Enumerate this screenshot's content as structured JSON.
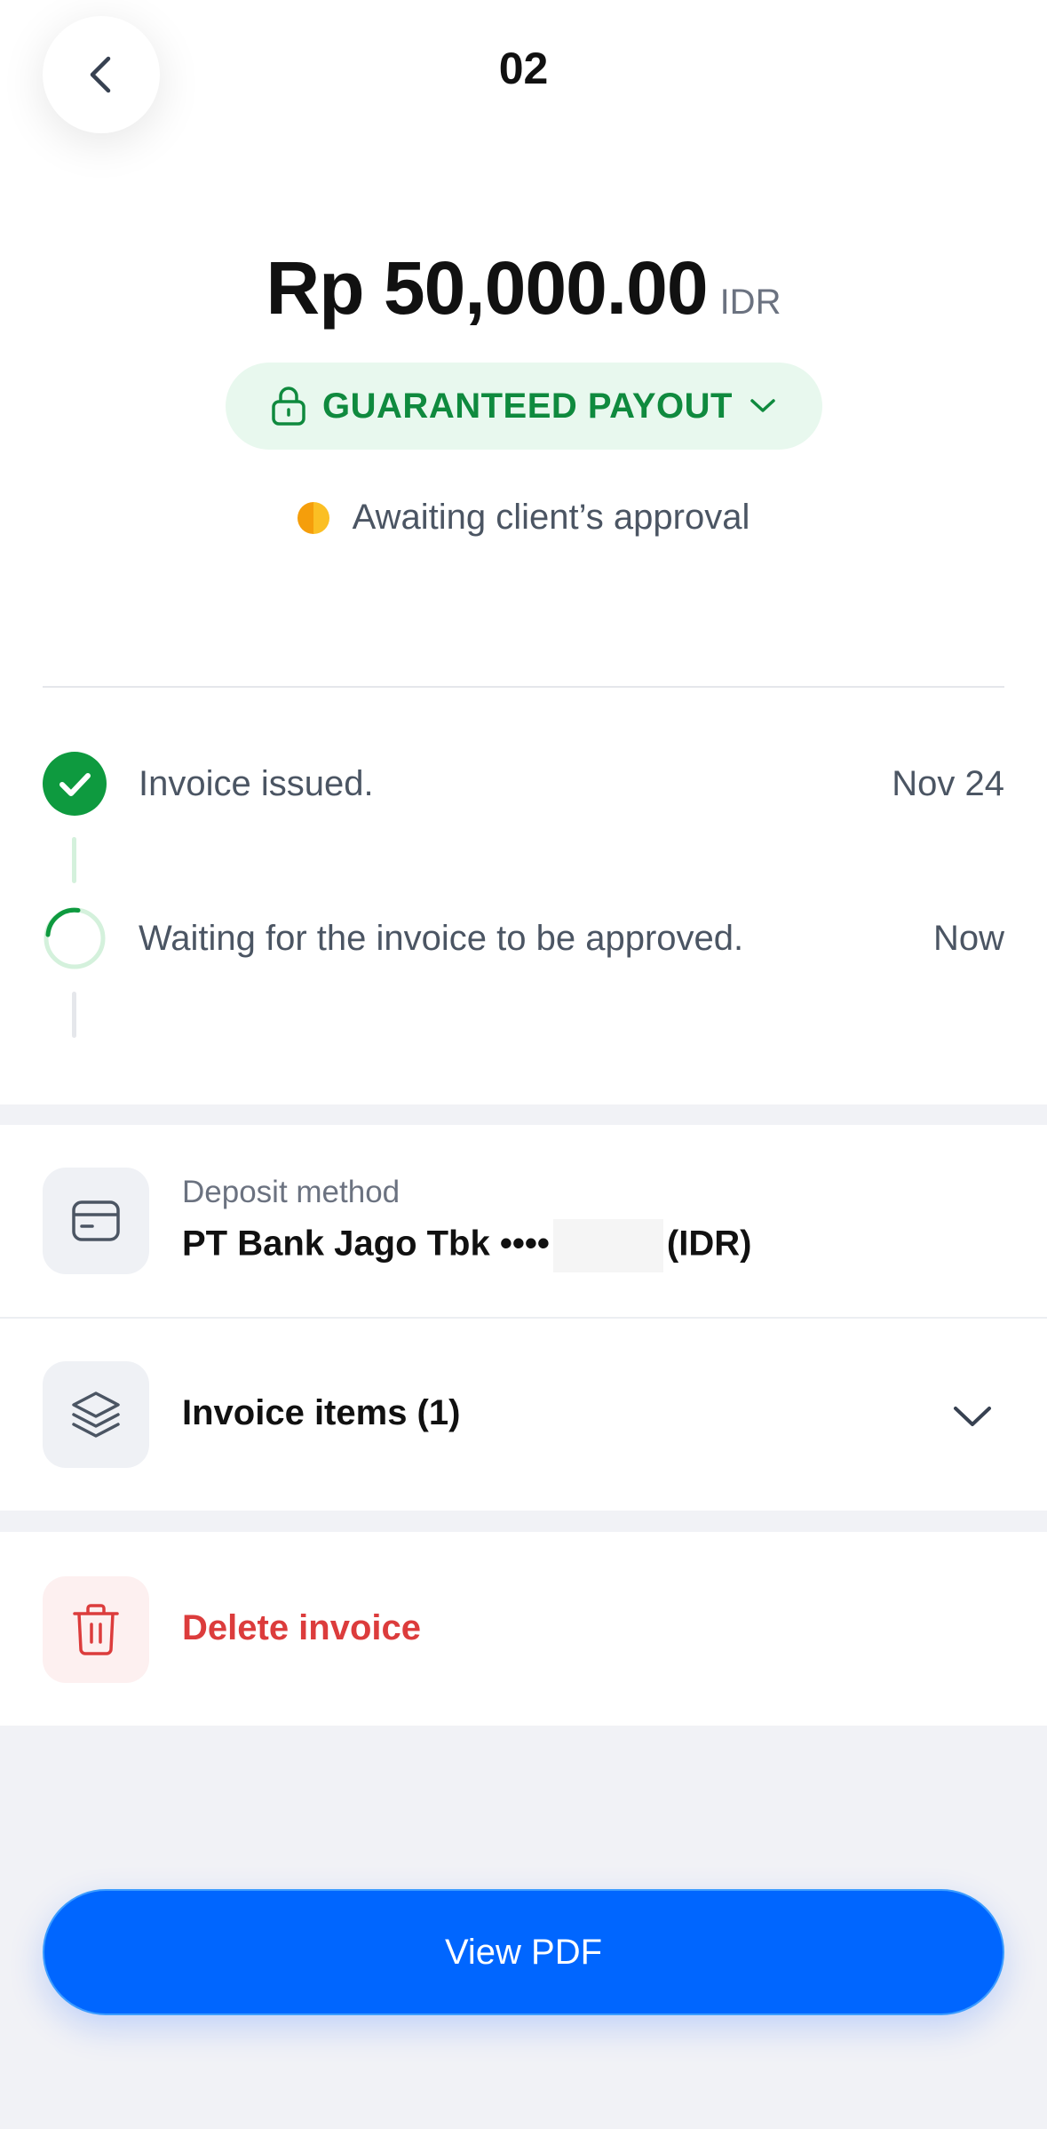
{
  "header": {
    "title": "02"
  },
  "invoice": {
    "amount": "Rp 50,000.00",
    "currency": "IDR",
    "payout_label": "GUARANTEED PAYOUT",
    "status": "Awaiting client’s approval"
  },
  "timeline": [
    {
      "text": "Invoice issued.",
      "date": "Nov 24",
      "state": "done"
    },
    {
      "text": "Waiting for the invoice to be approved.",
      "date": "Now",
      "state": "pending"
    }
  ],
  "deposit": {
    "label": "Deposit method",
    "bank": "PT Bank Jago Tbk",
    "mask": "••••",
    "currency": "(IDR)"
  },
  "items": {
    "label": "Invoice items (1)"
  },
  "delete": {
    "label": "Delete invoice"
  },
  "footer": {
    "pdf_label": "View PDF"
  },
  "colors": {
    "accent_blue": "#0066ff",
    "success_green": "#0f8a3e",
    "danger_red": "#dc3c3c",
    "pending_orange": "#f59e0b"
  }
}
